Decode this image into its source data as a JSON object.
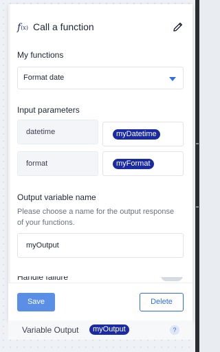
{
  "panel": {
    "title": "Call a function",
    "function_icon_text": "f(x)"
  },
  "my_functions": {
    "label": "My functions",
    "selected": "Format date"
  },
  "input_parameters": {
    "label": "Input parameters",
    "rows": [
      {
        "name": "datetime",
        "value": "myDatetime"
      },
      {
        "name": "format",
        "value": "myFormat"
      }
    ]
  },
  "output_variable": {
    "label": "Output variable name",
    "description": "Please choose a name for the output response of your functions.",
    "value": "myOutput"
  },
  "footer": {
    "save_label": "Save",
    "delete_label": "Delete"
  },
  "under_panel": {
    "label": "Variable Output",
    "chip": "myOutput",
    "help": "?"
  },
  "colors": {
    "accent": "#2f6fe0",
    "chip": "#1a2aa3",
    "save_button": "#5b8fe6"
  }
}
